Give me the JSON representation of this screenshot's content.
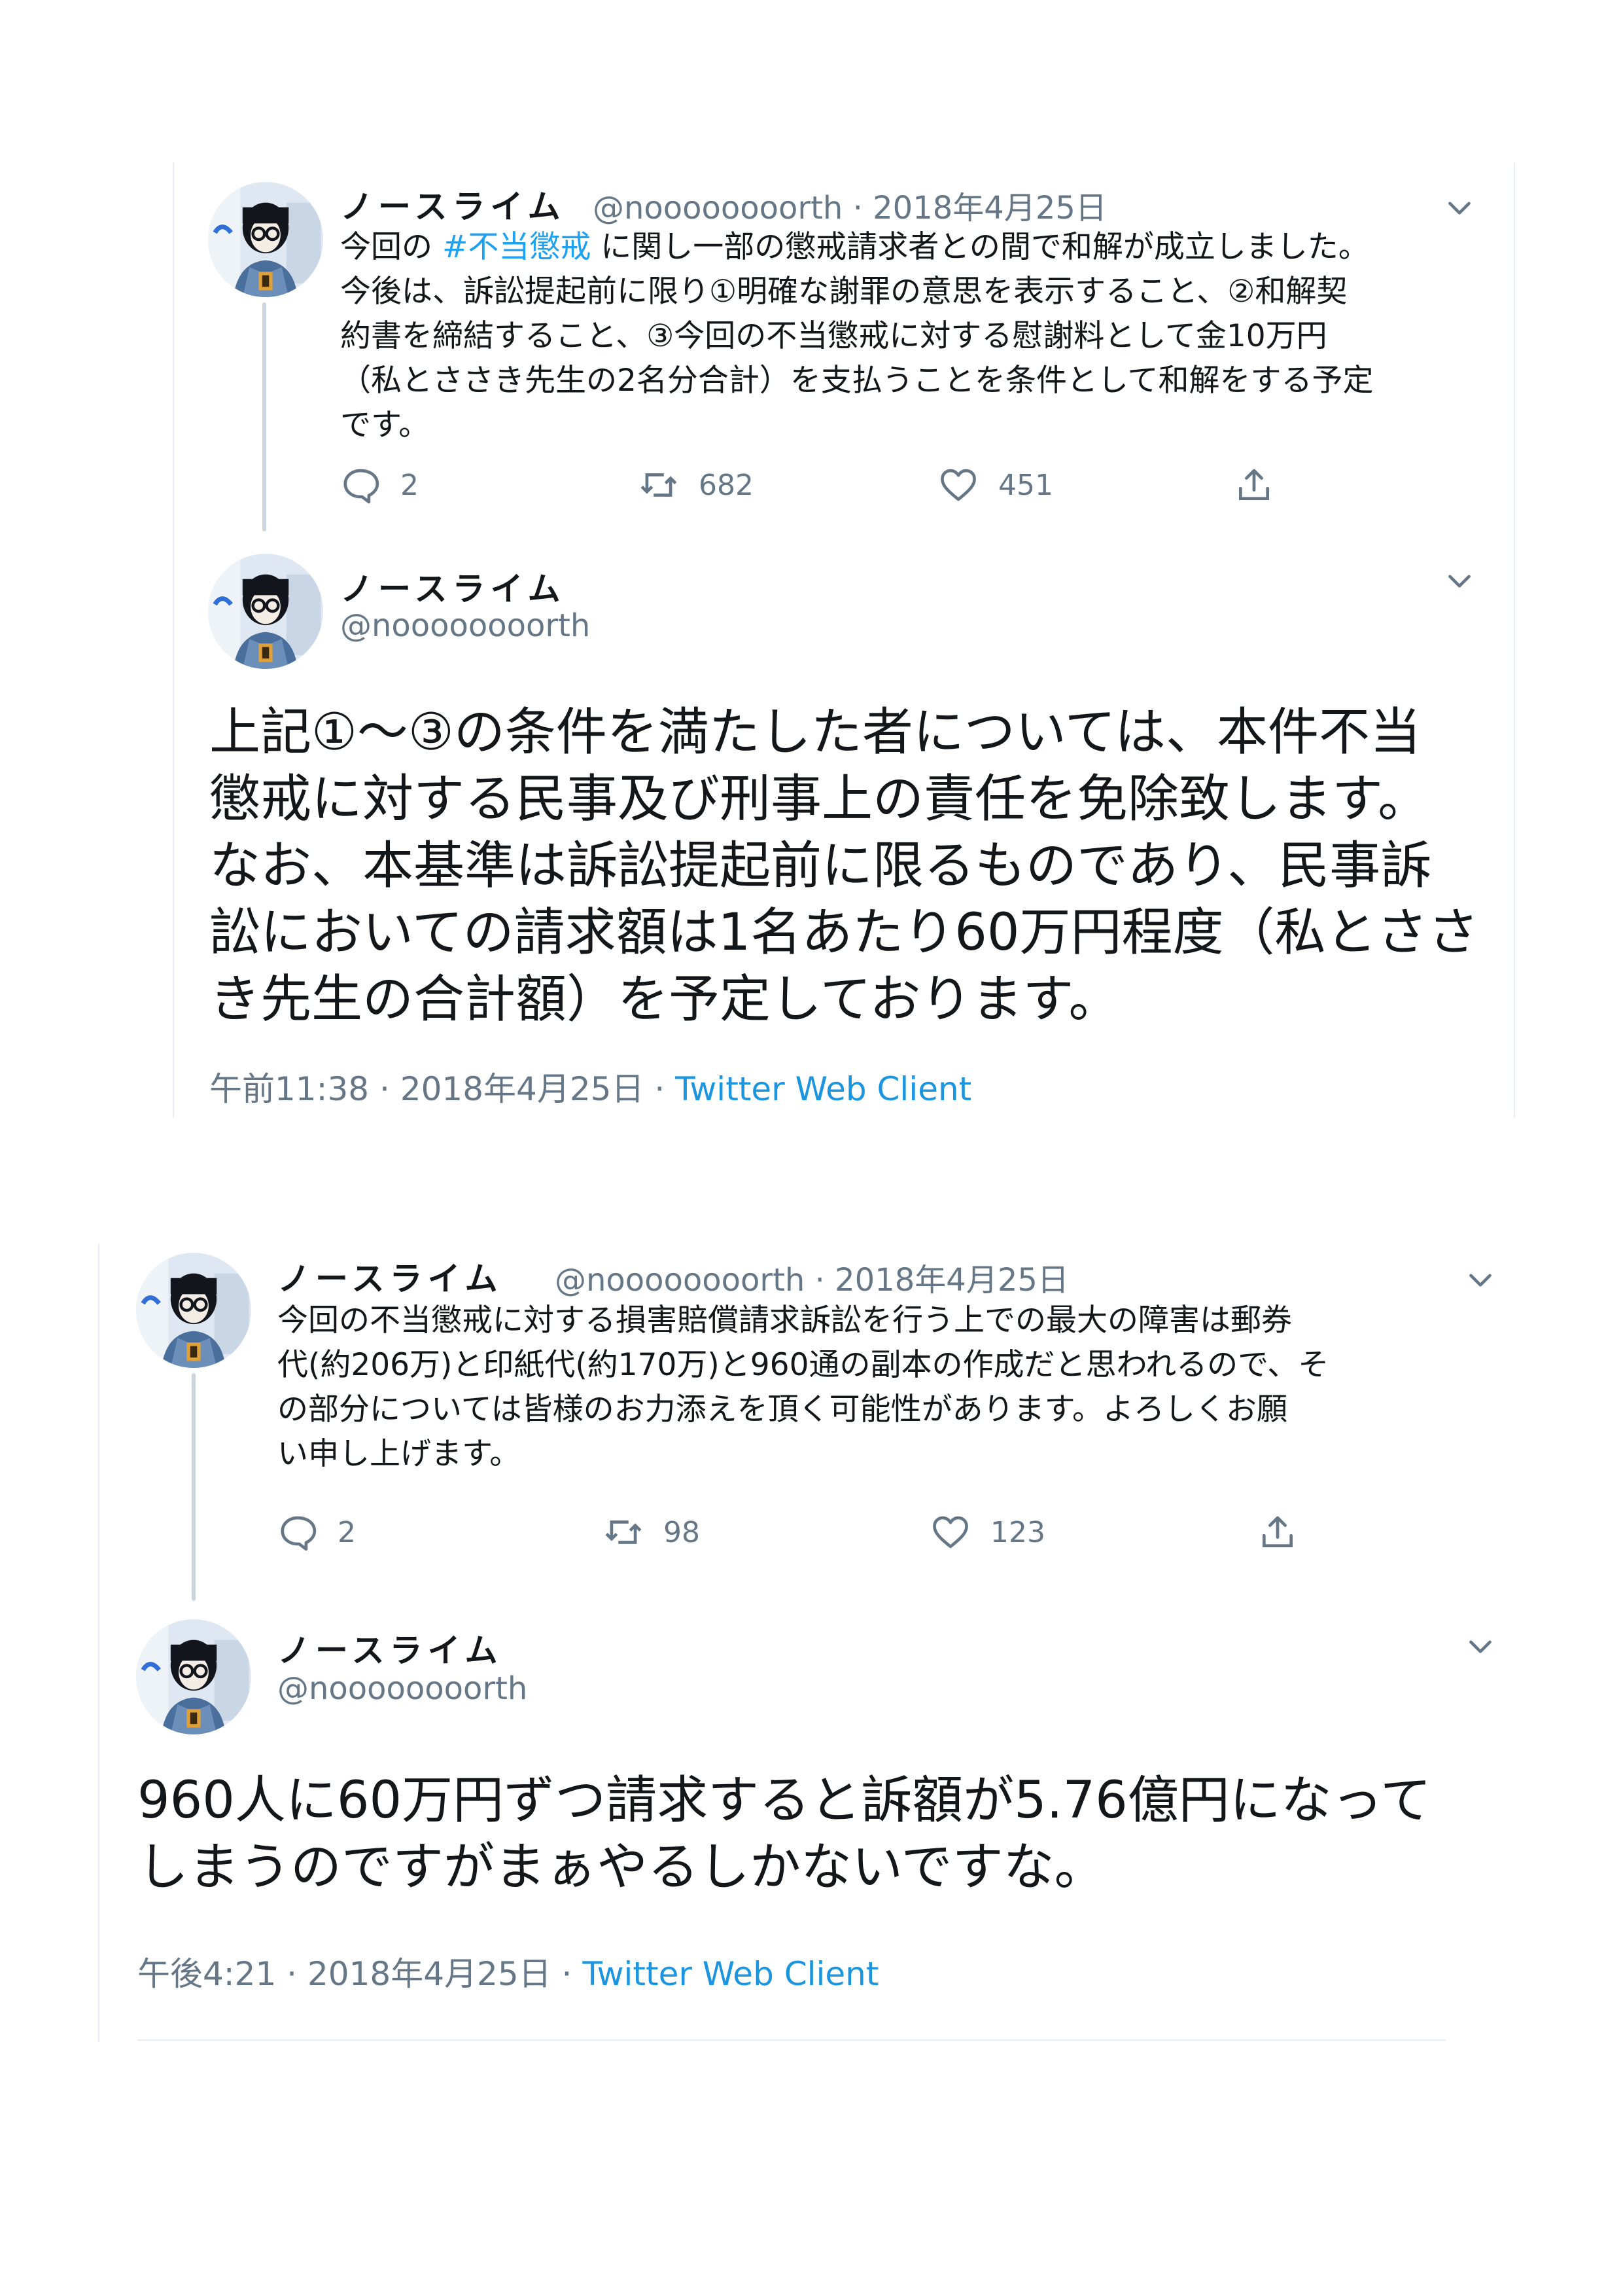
{
  "threads": [
    {
      "parent": {
        "name": "ノースライム",
        "handle": "@noooooooorth",
        "sep": " · ",
        "date": "2018年4月25日",
        "text_pre": "今回の ",
        "hashtag": "#不当懲戒",
        "text_post": " に関し一部の懲戒請求者との間で和解が成立しました。\n今後は、訴訟提起前に限り①明確な謝罪の意思を表示すること、②和解契\n約書を締結すること、③今回の不当懲戒に対する慰謝料として金10万円\n（私とささき先生の2名分合計）を支払うことを条件として和解をする予定\nです。",
        "reply_count": "2",
        "retweet_count": "682",
        "like_count": "451"
      },
      "main": {
        "name": "ノースライム",
        "handle": "@noooooooorth",
        "text": "上記①～③の条件を満たした者については、本件不当\n懲戒に対する民事及び刑事上の責任を免除致します。\nなお、本基準は訴訟提起前に限るものであり、民事訴\n訟においての請求額は1名あたり60万円程度（私とささ\nき先生の合計額）を予定しております。",
        "timestamp": "午前11:38 · 2018年4月25日 · ",
        "client": "Twitter Web Client"
      }
    },
    {
      "parent": {
        "name": "ノースライム",
        "handle": "@noooooooorth",
        "sep": " · ",
        "date": "2018年4月25日",
        "text": "今回の不当懲戒に対する損害賠償請求訴訟を行う上での最大の障害は郵券\n代(約206万)と印紙代(約170万)と960通の副本の作成だと思われるので、そ\nの部分については皆様のお力添えを頂く可能性があります。よろしくお願\nい申し上げます。",
        "reply_count": "2",
        "retweet_count": "98",
        "like_count": "123"
      },
      "main": {
        "name": "ノースライム",
        "handle": "@noooooooorth",
        "text": "960人に60万円ずつ請求すると訴額が5.76億円になって\nしまうのですがまぁやるしかないですな。",
        "timestamp": "午後4:21 · 2018年4月25日 · ",
        "client": "Twitter Web Client"
      }
    }
  ],
  "icons": [
    "avatar",
    "chevron-down-icon",
    "reply-icon",
    "retweet-icon",
    "like-icon",
    "share-icon"
  ],
  "colors": {
    "link": "#1b95e0",
    "hashtag": "#1da1f2",
    "muted": "#657786",
    "line": "#ccd6dd"
  }
}
